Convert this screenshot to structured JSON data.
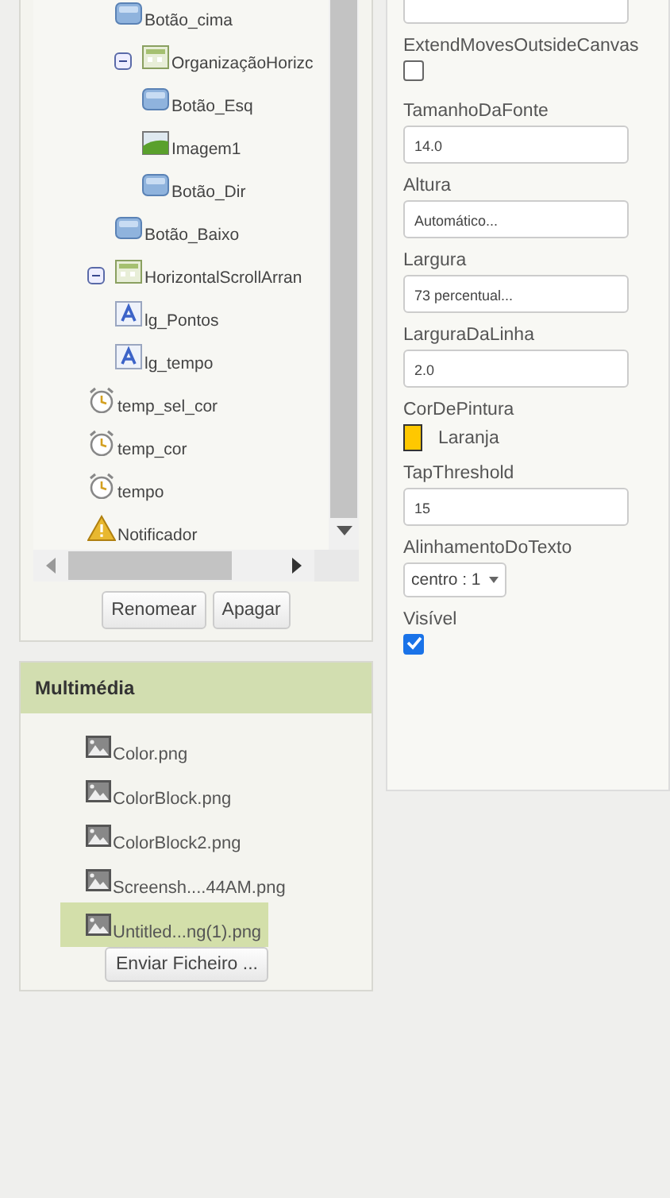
{
  "tree": {
    "continued_items": [
      {
        "label": "Botão_cima",
        "kind": "button"
      },
      {
        "label": "OrganizaçãoHorizc",
        "kind": "arrangement",
        "expanded": true,
        "children": [
          {
            "label": "Botão_Esq",
            "kind": "button"
          },
          {
            "label": "Imagem1",
            "kind": "image"
          },
          {
            "label": "Botão_Dir",
            "kind": "button"
          }
        ]
      },
      {
        "label": "Botão_Baixo",
        "kind": "button"
      }
    ],
    "items": [
      {
        "label": "HorizontalScrollArran",
        "kind": "arrangement",
        "expanded": true,
        "children": [
          {
            "label": "lg_Pontos",
            "kind": "label"
          },
          {
            "label": "lg_tempo",
            "kind": "label"
          }
        ]
      },
      {
        "label": "temp_sel_cor",
        "kind": "clock"
      },
      {
        "label": "temp_cor",
        "kind": "clock"
      },
      {
        "label": "tempo",
        "kind": "clock"
      },
      {
        "label": "Notificador",
        "kind": "notifier"
      }
    ],
    "buttons": [
      "Renomear",
      "Apagar"
    ]
  },
  "media": {
    "title": "Multimédia",
    "files": [
      {
        "label": "Color.png",
        "selected": false
      },
      {
        "label": "ColorBlock.png",
        "selected": false
      },
      {
        "label": "ColorBlock2.png",
        "selected": false
      },
      {
        "label": "Screensh....44AM.png",
        "selected": false
      },
      {
        "label": "Untitled...ng(1).png",
        "selected": true
      }
    ],
    "upload_button": "Enviar Ficheiro ..."
  },
  "properties": [
    {
      "kind": "textbox"
    },
    {
      "kind": "checkbox",
      "label": "ExtendMovesOutsideCanvas",
      "checked": false
    },
    {
      "kind": "textbox",
      "label": "TamanhoDaFonte",
      "value": "14.0"
    },
    {
      "kind": "textbox",
      "label": "Altura",
      "value": "Automático..."
    },
    {
      "kind": "textbox",
      "label": "Largura",
      "value": "73 percentual..."
    },
    {
      "kind": "textbox",
      "label": "LarguraDaLinha",
      "value": "2.0"
    },
    {
      "kind": "color",
      "label": "CorDePintura",
      "value": "Laranja",
      "color": "#ffc800"
    },
    {
      "kind": "textbox",
      "label": "TapThreshold",
      "value": "15"
    },
    {
      "kind": "dropdown",
      "label": "AlinhamentoDoTexto",
      "value": "centro : 1"
    },
    {
      "kind": "checkbox",
      "label": "Visível",
      "checked": true
    }
  ]
}
